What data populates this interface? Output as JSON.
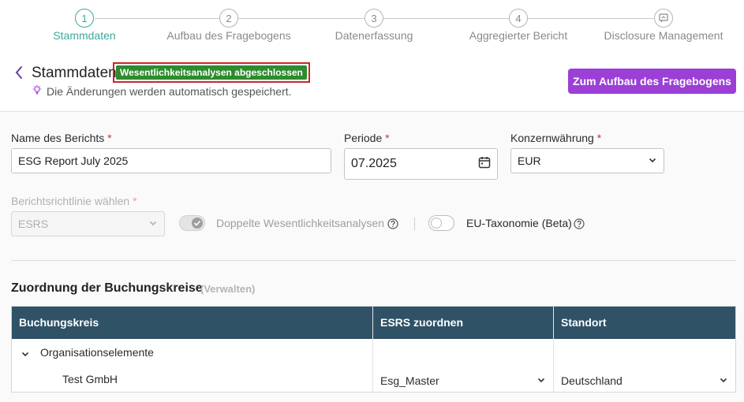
{
  "stepper": {
    "steps": [
      {
        "number": "1",
        "label": "Stammdaten",
        "active": true
      },
      {
        "number": "2",
        "label": "Aufbau des Fragebogens",
        "active": false
      },
      {
        "number": "3",
        "label": "Datenerfassung",
        "active": false
      },
      {
        "number": "4",
        "label": "Aggregierter Bericht",
        "active": false
      },
      {
        "number": "",
        "label": "Disclosure Management",
        "active": false,
        "icon": "report-icon"
      }
    ]
  },
  "header": {
    "title": "Stammdaten",
    "status_badge": "Wesentlichkeitsanalysen abgeschlossen",
    "autosave_text": "Die Änderungen werden automatisch gespeichert.",
    "next_button": "Zum Aufbau des Fragebogens",
    "accent_color": "#9b3fd6",
    "badge_color": "#2e8b2e"
  },
  "form": {
    "report_name": {
      "label": "Name des Berichts",
      "value": "ESG Report July 2025"
    },
    "period": {
      "label": "Periode",
      "value": "07.2025"
    },
    "currency": {
      "label": "Konzernwährung",
      "value": "EUR"
    },
    "guideline": {
      "label": "Berichtsrichtlinie wählen",
      "value": "ESRS"
    },
    "double_materiality": {
      "label": "Doppelte Wesentlichkeitsanalysen",
      "checked": true,
      "disabled": true
    },
    "eu_taxonomy": {
      "label": "EU-Taxonomie (Beta)",
      "checked": false
    },
    "required_mark": "*"
  },
  "section": {
    "title": "Zuordnung der Buchungskreise",
    "manage_link": "(Verwalten)"
  },
  "table": {
    "headers": [
      "Buchungskreis",
      "ESRS zuordnen",
      "Standort"
    ],
    "group_row": {
      "label": "Organisationselemente"
    },
    "rows": [
      {
        "name": "Test GmbH",
        "esrs": "Esg_Master",
        "location": "Deutschland"
      }
    ],
    "header_color": "#2f5266"
  }
}
